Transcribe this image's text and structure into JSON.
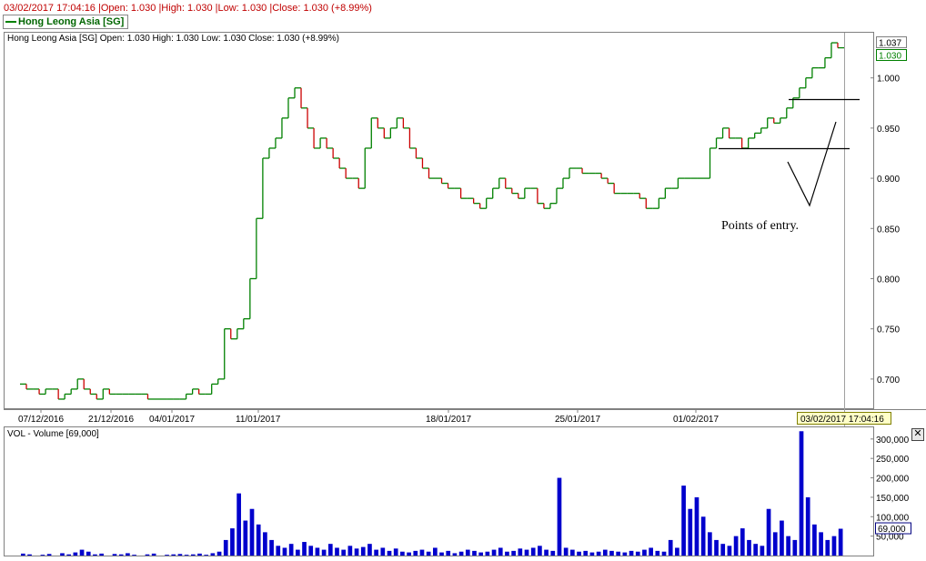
{
  "top_info": "03/02/2017 17:04:16 |Open: 1.030 |High: 1.030 |Low: 1.030 |Close: 1.030 (+8.99%)",
  "legend_tag": "Hong Leong Asia [SG]",
  "close_icon": "close-icon",
  "chart_data": [
    {
      "type": "line",
      "header": "Hong Leong Asia [SG] Open: 1.030  High: 1.030  Low: 1.030  Close: 1.030 (+8.99%)",
      "x_tick_labels": [
        "07/12/2016",
        "21/12/2016",
        "04/01/2017",
        "11/01/2017",
        "18/01/2017",
        "25/01/2017",
        "01/02/2017"
      ],
      "cursor_date_label": "03/02/2017 17:04:16",
      "y_ticks": [
        0.7,
        0.75,
        0.8,
        0.85,
        0.9,
        0.95,
        1.0
      ],
      "y_tick_labels": [
        "0.700",
        "0.750",
        "0.800",
        "0.850",
        "0.900",
        "0.950",
        "1.000"
      ],
      "ylim": [
        0.67,
        1.045
      ],
      "high_label": "1.037",
      "last_label": "1.030",
      "series": [
        {
          "values": [
            0.695,
            0.69,
            0.69,
            0.685,
            0.69,
            0.69,
            0.68,
            0.685,
            0.69,
            0.7,
            0.69,
            0.685,
            0.68,
            0.69,
            0.685,
            0.685,
            0.685,
            0.685,
            0.685,
            0.685,
            0.68,
            0.68,
            0.68,
            0.68,
            0.68,
            0.68,
            0.685,
            0.69,
            0.685,
            0.685,
            0.695,
            0.7,
            0.75,
            0.74,
            0.75,
            0.76,
            0.8,
            0.86,
            0.92,
            0.93,
            0.94,
            0.96,
            0.98,
            0.99,
            0.97,
            0.95,
            0.93,
            0.94,
            0.93,
            0.92,
            0.91,
            0.9,
            0.9,
            0.89,
            0.93,
            0.96,
            0.95,
            0.94,
            0.95,
            0.96,
            0.95,
            0.93,
            0.92,
            0.91,
            0.9,
            0.9,
            0.895,
            0.89,
            0.89,
            0.88,
            0.88,
            0.875,
            0.87,
            0.88,
            0.89,
            0.9,
            0.89,
            0.885,
            0.88,
            0.89,
            0.89,
            0.875,
            0.87,
            0.875,
            0.89,
            0.9,
            0.91,
            0.91,
            0.905,
            0.905,
            0.905,
            0.9,
            0.895,
            0.885,
            0.885,
            0.885,
            0.885,
            0.88,
            0.87,
            0.87,
            0.88,
            0.89,
            0.89,
            0.9,
            0.9,
            0.9,
            0.9,
            0.9,
            0.93,
            0.94,
            0.95,
            0.94,
            0.94,
            0.93,
            0.94,
            0.945,
            0.95,
            0.96,
            0.955,
            0.96,
            0.97,
            0.98,
            0.99,
            1.0,
            1.01,
            1.01,
            1.02,
            1.035,
            1.03
          ]
        }
      ],
      "annotation": "Points of entry.",
      "hlines": [
        0.98,
        0.93
      ]
    },
    {
      "type": "bar",
      "header": "VOL - Volume [69,000]",
      "y_ticks": [
        50000,
        100000,
        150000,
        200000,
        250000,
        300000
      ],
      "y_tick_labels": [
        "50,000",
        "100,000",
        "150,000",
        "200,000",
        "250,000",
        "300,000"
      ],
      "ylim": [
        0,
        330000
      ],
      "last_label": "69,000",
      "values": [
        5000,
        3000,
        0,
        2000,
        4000,
        0,
        6000,
        3000,
        8000,
        15000,
        10000,
        3000,
        5000,
        0,
        4000,
        3000,
        6000,
        2000,
        0,
        3000,
        5000,
        0,
        2000,
        3000,
        4000,
        2000,
        3000,
        5000,
        2000,
        6000,
        10000,
        40000,
        70000,
        160000,
        90000,
        120000,
        80000,
        60000,
        40000,
        25000,
        20000,
        30000,
        15000,
        35000,
        25000,
        20000,
        15000,
        30000,
        20000,
        15000,
        25000,
        18000,
        22000,
        30000,
        15000,
        20000,
        12000,
        18000,
        10000,
        8000,
        12000,
        15000,
        10000,
        20000,
        8000,
        12000,
        6000,
        10000,
        15000,
        12000,
        8000,
        10000,
        15000,
        20000,
        10000,
        12000,
        18000,
        15000,
        20000,
        25000,
        15000,
        12000,
        200000,
        20000,
        15000,
        10000,
        12000,
        8000,
        10000,
        15000,
        12000,
        10000,
        8000,
        12000,
        10000,
        15000,
        20000,
        12000,
        10000,
        40000,
        20000,
        180000,
        120000,
        150000,
        100000,
        60000,
        40000,
        30000,
        25000,
        50000,
        70000,
        40000,
        30000,
        25000,
        120000,
        60000,
        90000,
        50000,
        40000,
        320000,
        150000,
        80000,
        60000,
        40000,
        50000,
        69000
      ]
    }
  ]
}
